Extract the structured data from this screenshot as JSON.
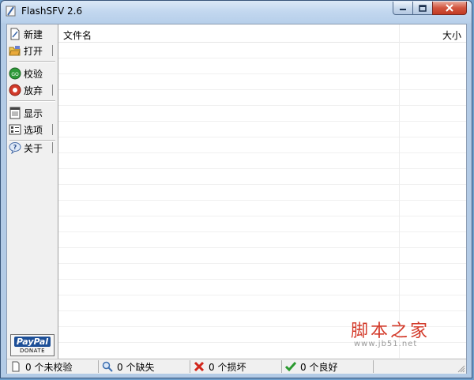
{
  "window": {
    "title": "FlashSFV 2.6"
  },
  "sidebar": {
    "items": [
      {
        "label": "新建",
        "icon": "new-file-icon"
      },
      {
        "label": "打开",
        "icon": "open-folder-icon"
      },
      {
        "label": "校验",
        "icon": "go-check-icon"
      },
      {
        "label": "放弃",
        "icon": "stop-icon"
      },
      {
        "label": "显示",
        "icon": "display-icon"
      },
      {
        "label": "选项",
        "icon": "options-icon"
      },
      {
        "label": "关于",
        "icon": "about-help-icon"
      }
    ],
    "donate": {
      "brand": "PayPal",
      "label": "DONATE"
    }
  },
  "list": {
    "columns": [
      "文件名",
      "大小"
    ],
    "rows": []
  },
  "statusbar": {
    "unchecked": "0 个未校验",
    "missing": "0 个缺失",
    "damaged": "0 个损坏",
    "good": "0 个良好"
  },
  "watermark": {
    "main": "脚本之家",
    "sub": "www.jb51.net"
  },
  "colors": {
    "watermark": "#d33a2a",
    "title_bar": "#c2d7ef",
    "close_button": "#c23a22"
  }
}
